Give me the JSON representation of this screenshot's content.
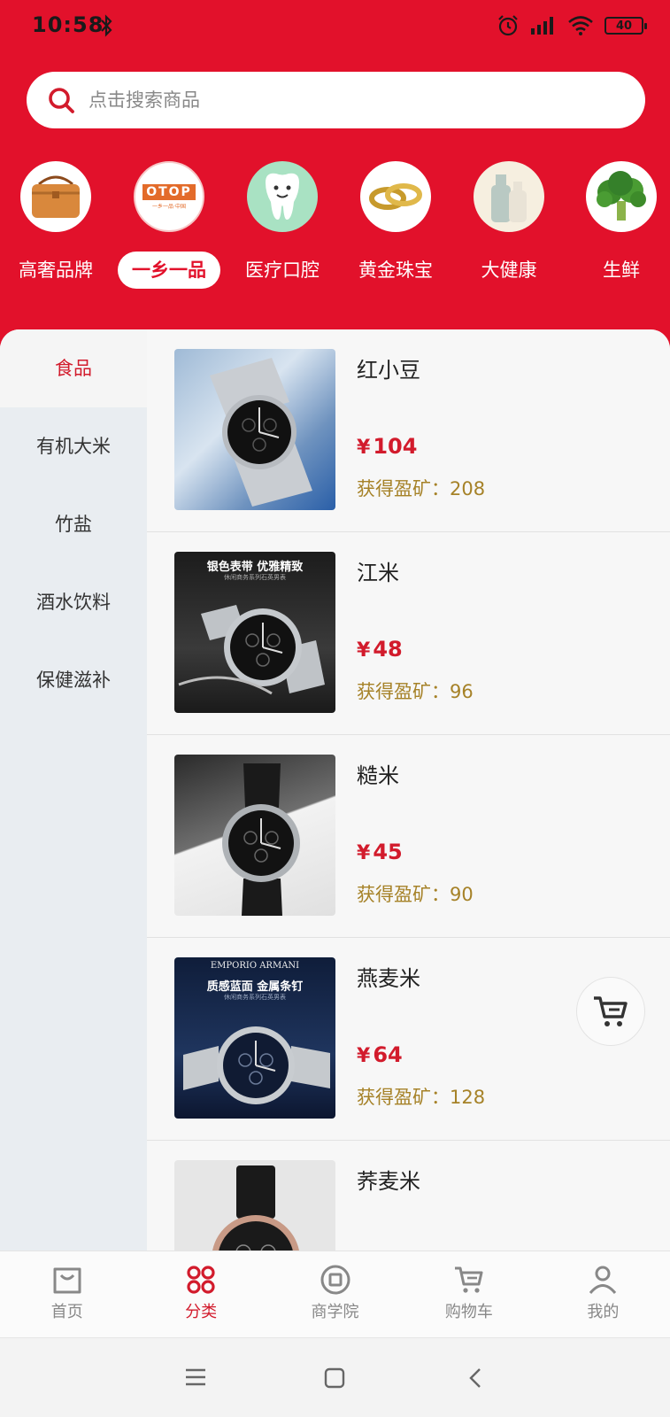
{
  "status_bar": {
    "time": "10:58",
    "battery": "40"
  },
  "search": {
    "placeholder": "点击搜索商品"
  },
  "categories": [
    {
      "label": "高奢品牌",
      "icon": "handbag-icon"
    },
    {
      "label": "一乡一品",
      "icon": "otop-logo-icon",
      "logo_text": "OTOP",
      "logo_sub": "一乡一品·中国"
    },
    {
      "label": "医疗口腔",
      "icon": "tooth-icon"
    },
    {
      "label": "黄金珠宝",
      "icon": "gold-rings-icon"
    },
    {
      "label": "大健康",
      "icon": "bottles-icon"
    },
    {
      "label": "生鲜",
      "icon": "broccoli-icon"
    }
  ],
  "active_category": "一乡一品",
  "sidebar": {
    "items": [
      {
        "label": "食品"
      },
      {
        "label": "有机大米"
      },
      {
        "label": "竹盐"
      },
      {
        "label": "酒水饮料"
      },
      {
        "label": "保健滋补"
      }
    ]
  },
  "products": [
    {
      "name": "红小豆",
      "currency": "¥",
      "price": "104",
      "reward_label": "获得盈矿：",
      "reward": "208",
      "image": "watch-image"
    },
    {
      "name": "江米",
      "currency": "¥",
      "price": "48",
      "reward_label": "获得盈矿：",
      "reward": "96",
      "image": "watch-image",
      "banner": "银色表带 优雅精致",
      "banner_sub": "休闲商务系列石英男表"
    },
    {
      "name": "糙米",
      "currency": "¥",
      "price": "45",
      "reward_label": "获得盈矿：",
      "reward": "90",
      "image": "watch-image"
    },
    {
      "name": "燕麦米",
      "currency": "¥",
      "price": "64",
      "reward_label": "获得盈矿：",
      "reward": "128",
      "image": "watch-image",
      "brand": "EMPORIO ARMANI",
      "banner": "质感蓝面 金属条钉",
      "banner_sub": "休闲商务系列石英男表"
    },
    {
      "name": "荞麦米",
      "currency": "",
      "price": "",
      "reward_label": "",
      "reward": "",
      "image": "watch-image"
    }
  ],
  "bottom_nav": [
    {
      "label": "首页",
      "icon": "home-icon"
    },
    {
      "label": "分类",
      "icon": "category-icon"
    },
    {
      "label": "商学院",
      "icon": "academy-icon"
    },
    {
      "label": "购物车",
      "icon": "cart-icon"
    },
    {
      "label": "我的",
      "icon": "profile-icon"
    }
  ],
  "active_nav": "分类",
  "colors": {
    "brand_red": "#e2112b",
    "price_red": "#d21b2c",
    "reward_gold": "#a68228"
  }
}
